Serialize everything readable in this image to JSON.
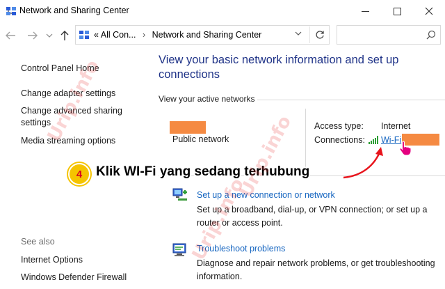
{
  "window": {
    "title": "Network and Sharing Center"
  },
  "address_bar": {
    "breadcrumb_root": "All Con...",
    "breadcrumb_current": "Network and Sharing Center",
    "search_placeholder": ""
  },
  "left_nav": {
    "items": [
      {
        "label": "Control Panel Home"
      },
      {
        "label": "Change adapter settings"
      },
      {
        "label": "Change advanced sharing settings"
      },
      {
        "label": "Media streaming options"
      }
    ],
    "see_also_label": "See also",
    "see_also_items": [
      {
        "label": "Internet Options"
      },
      {
        "label": "Windows Defender Firewall"
      }
    ]
  },
  "main": {
    "heading": "View your basic network information and set up connections",
    "active_networks_label": "View your active networks",
    "network": {
      "type": "Public network",
      "access_type_label": "Access type:",
      "access_type_value": "Internet",
      "connections_label": "Connections:",
      "connection_link": "Wi-Fi"
    },
    "tasks": [
      {
        "link": "Set up a new connection or network",
        "description": "Set up a broadband, dial-up, or VPN connection; or set up a router or access point.",
        "icon": "network-setup-icon"
      },
      {
        "link": "Troubleshoot problems",
        "description": "Diagnose and repair network problems, or get troubleshooting information.",
        "icon": "troubleshoot-icon"
      }
    ]
  },
  "annotation": {
    "step_number": "4",
    "instruction": "Klik WI-Fi yang sedang terhubung"
  },
  "watermark": {
    "text": "Urip.info"
  },
  "colors": {
    "link": "#1565c0",
    "heading": "#1e3287",
    "redaction": "#f58a42",
    "badge": "#f5c400",
    "badge_number": "#d9001b",
    "arrow": "#e8141c"
  }
}
